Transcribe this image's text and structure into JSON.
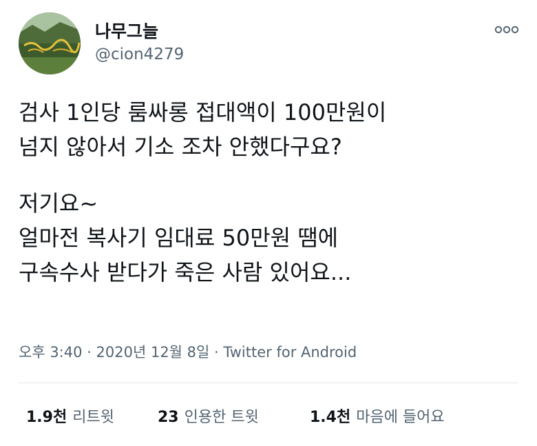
{
  "user": {
    "display_name": "나무그늘",
    "handle": "@cion4279",
    "avatar_icon": "avatar-landscape-image"
  },
  "more_icon": "more-dots-icon",
  "tweet": {
    "lines": [
      "검사 1인당 룸싸롱 접대액이 100만원이",
      "넘지 않아서 기소 조차 안했다구요?",
      "",
      "저기요~",
      "얼마전 복사기 임대료 50만원 땜에",
      "구속수사 받다가 죽은 사람 있어요..."
    ]
  },
  "meta": {
    "time": "오후 3:40",
    "separator1": " · ",
    "date": "2020년 12월 8일",
    "separator2": " · ",
    "source": "Twitter for Android"
  },
  "stats": [
    {
      "num": "1.9천",
      "label": "리트윗"
    },
    {
      "num": "23",
      "label": "인용한 트윗"
    },
    {
      "num": "1.4천",
      "label": "마음에 들어요"
    }
  ],
  "colors": {
    "text_primary": "#0f1419",
    "text_secondary": "#536471",
    "divider": "#e1e8ed"
  }
}
